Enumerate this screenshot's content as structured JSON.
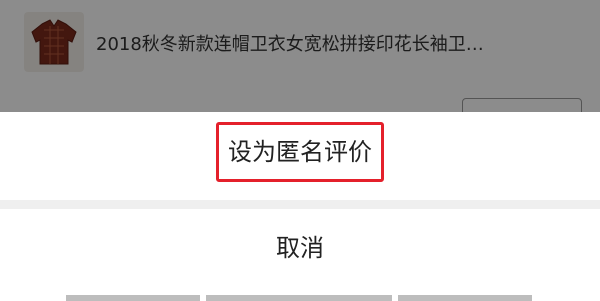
{
  "background": {
    "product_title": "2018秋冬新款连帽卫衣女宽松拼接印花长袖卫…",
    "product_image_icon": "jacket-image"
  },
  "sheet": {
    "anonymous_option": "设为匿名评价",
    "cancel_label": "取消"
  },
  "colors": {
    "highlight": "#e4202b",
    "overlay": "rgba(0,0,0,0.45)"
  }
}
